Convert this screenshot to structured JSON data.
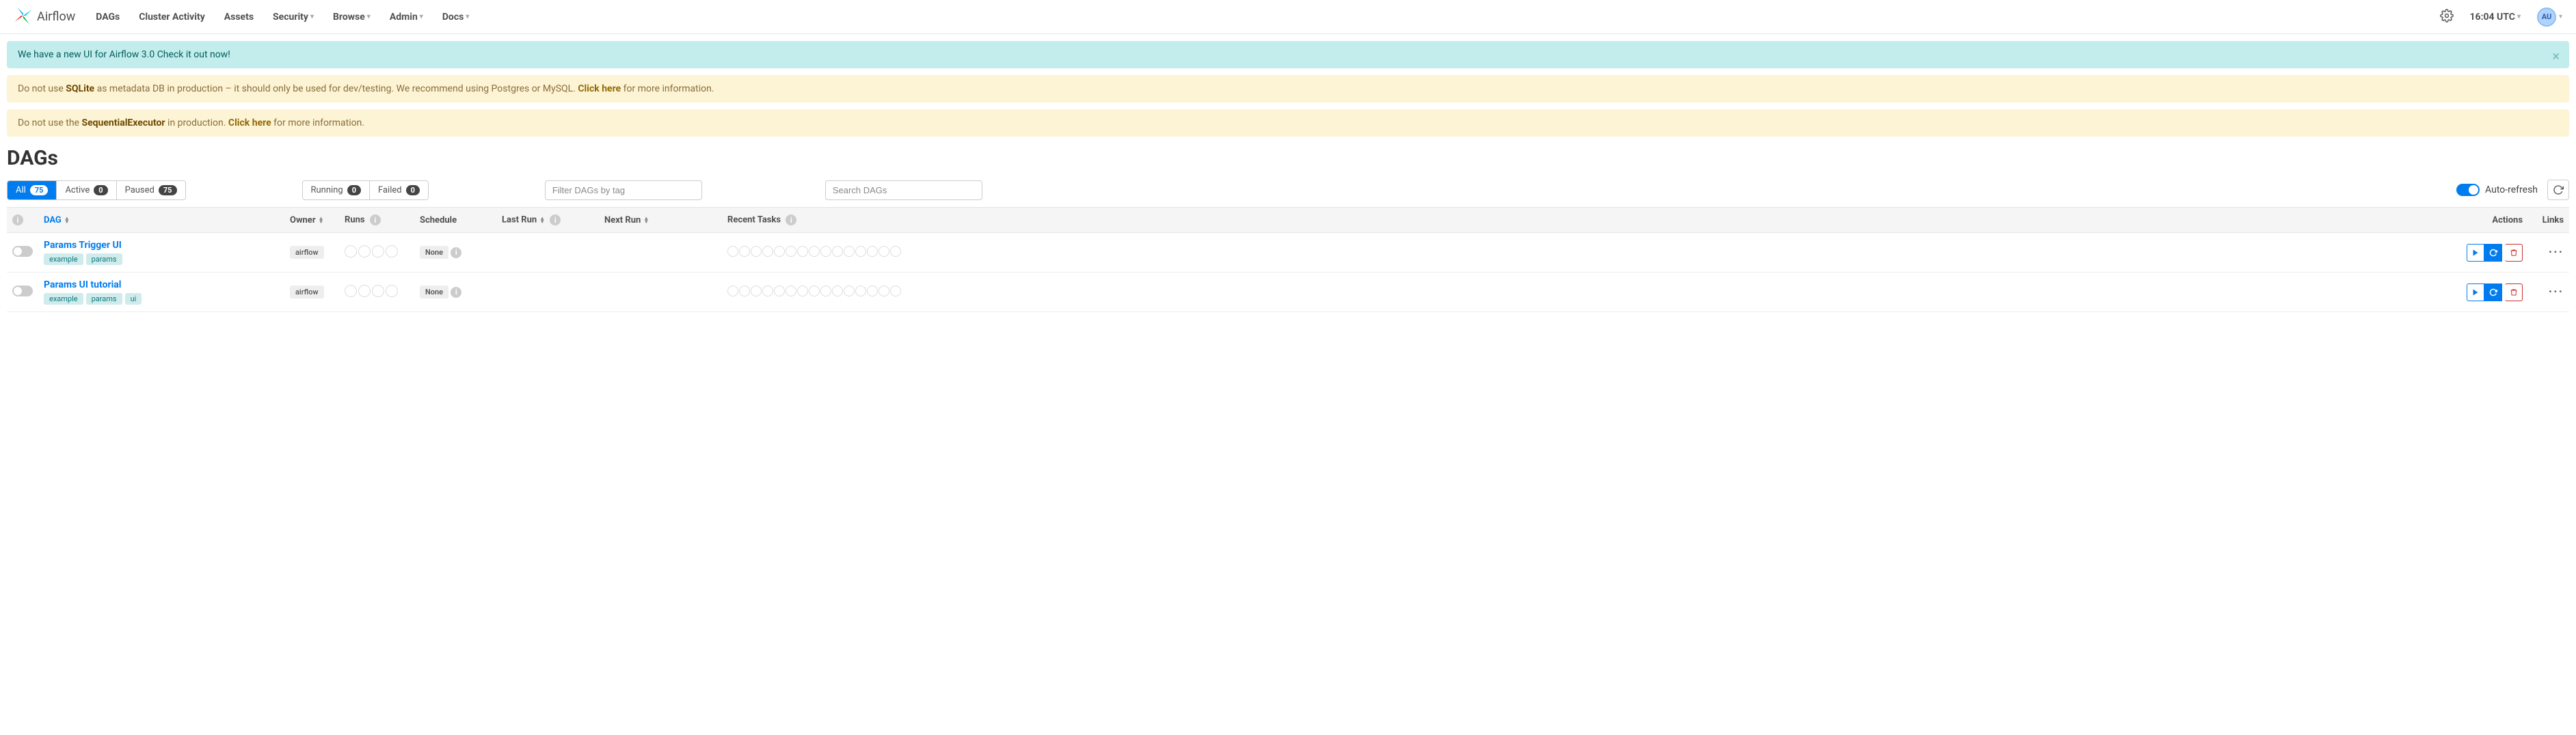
{
  "brand": "Airflow",
  "nav": [
    "DAGs",
    "Cluster Activity",
    "Assets",
    "Security",
    "Browse",
    "Admin",
    "Docs"
  ],
  "nav_dropdown": [
    false,
    false,
    false,
    true,
    true,
    true,
    true
  ],
  "clock": "16:04 UTC",
  "avatar": "AU",
  "alerts": [
    {
      "type": "info",
      "text": "We have a new UI for Airflow 3.0 Check it out now!"
    },
    {
      "type": "warn",
      "pre": "Do not use ",
      "bold1": "SQLite",
      "mid": " as metadata DB in production – it should only be used for dev/testing. We recommend using Postgres or MySQL. ",
      "link": "Click here",
      "post": " for more information."
    },
    {
      "type": "warn",
      "pre": "Do not use the ",
      "bold1": "SequentialExecutor",
      "mid": " in production. ",
      "link": "Click here",
      "post": " for more information."
    }
  ],
  "title": "DAGs",
  "status_filters": [
    {
      "label": "All",
      "count": "75",
      "active": true
    },
    {
      "label": "Active",
      "count": "0"
    },
    {
      "label": "Paused",
      "count": "75"
    }
  ],
  "run_filters": [
    {
      "label": "Running",
      "count": "0"
    },
    {
      "label": "Failed",
      "count": "0"
    }
  ],
  "tag_placeholder": "Filter DAGs by tag",
  "search_placeholder": "Search DAGs",
  "autorefresh_label": "Auto-refresh",
  "columns": {
    "dag": "DAG",
    "owner": "Owner",
    "runs": "Runs",
    "schedule": "Schedule",
    "last_run": "Last Run",
    "next_run": "Next Run",
    "recent": "Recent Tasks",
    "actions": "Actions",
    "links": "Links"
  },
  "rows": [
    {
      "name": "Params Trigger UI",
      "tags": [
        "example",
        "params"
      ],
      "owner": "airflow",
      "schedule": "None"
    },
    {
      "name": "Params UI tutorial",
      "tags": [
        "example",
        "params",
        "ui"
      ],
      "owner": "airflow",
      "schedule": "None"
    }
  ]
}
